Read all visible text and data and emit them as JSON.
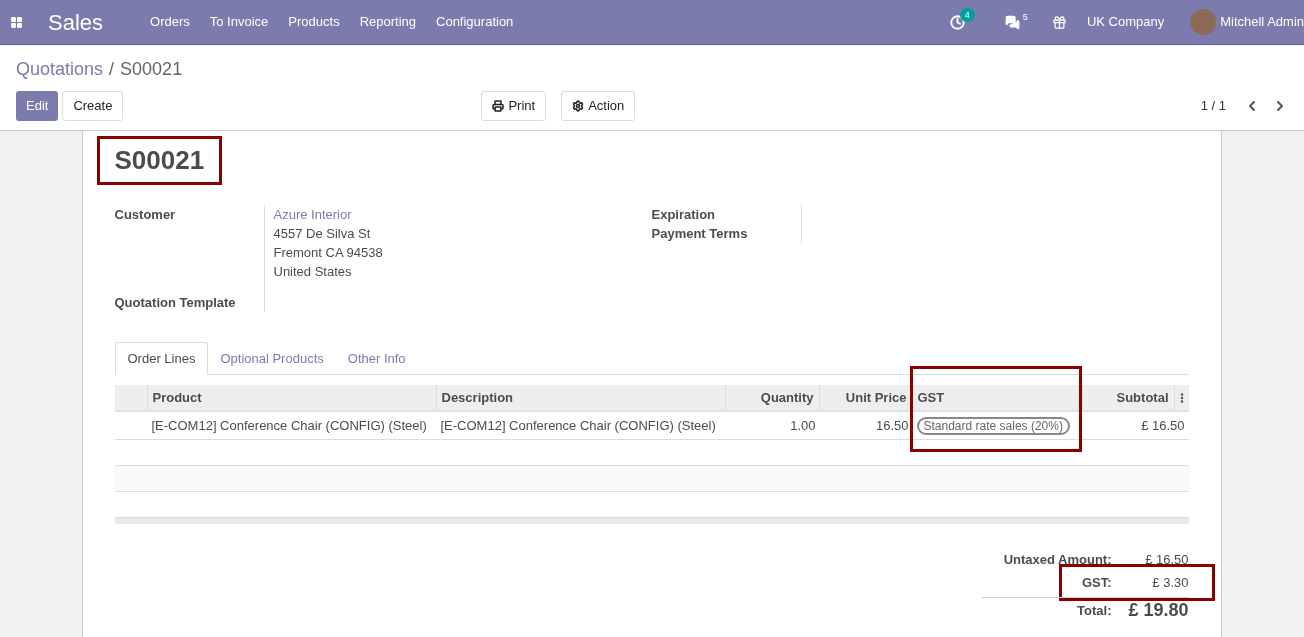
{
  "navbar": {
    "app_name": "Sales",
    "menu": [
      "Orders",
      "To Invoice",
      "Products",
      "Reporting",
      "Configuration"
    ],
    "activity_count": "4",
    "message_count": "5",
    "company": "UK Company",
    "user": "Mitchell Admin"
  },
  "breadcrumb": {
    "parent": "Quotations",
    "separator": "/",
    "current": "S00021"
  },
  "buttons": {
    "edit": "Edit",
    "create": "Create",
    "print": "Print",
    "action": "Action"
  },
  "pager": "1 / 1",
  "form": {
    "title": "S00021",
    "title_highlighted": true,
    "left_fields": [
      {
        "label": "Customer",
        "lines": [
          {
            "text": "Azure Interior",
            "link": true
          },
          {
            "text": "4557 De Silva St",
            "link": false
          },
          {
            "text": "Fremont CA 94538",
            "link": false
          },
          {
            "text": "United States",
            "link": false
          }
        ]
      },
      {
        "label": "Quotation Template"
      }
    ],
    "right_fields": [
      {
        "label": "Expiration"
      },
      {
        "label": "Payment Terms"
      }
    ]
  },
  "tabs": [
    {
      "label": "Order Lines",
      "selected": true
    },
    {
      "label": "Optional Products",
      "selected": false
    },
    {
      "label": "Other Info",
      "selected": false
    }
  ],
  "table": {
    "columns": [
      {
        "label": "Product",
        "highlighted": false
      },
      {
        "label": "Description",
        "highlighted": false
      },
      {
        "label": "Quantity",
        "highlighted": false
      },
      {
        "label": "Unit Price",
        "highlighted": false
      },
      {
        "label": "GST",
        "highlighted": true
      },
      {
        "label": "Subtotal",
        "highlighted": false
      }
    ],
    "rows": [
      [
        "[E-COM12] Conference Chair (CONFIG) (Steel)",
        "[E-COM12] Conference Chair (CONFIG) (Steel)",
        "1.00",
        "16.50",
        {
          "tag": "Standard rate sales (20%)"
        },
        "£ 16.50"
      ]
    ]
  },
  "totals": [
    {
      "label": "Untaxed Amount:",
      "value": "£ 16.50",
      "highlighted": false,
      "kind": "line"
    },
    {
      "label": "GST:",
      "value": "£ 3.30",
      "highlighted": true,
      "kind": "line"
    },
    {
      "label": "Total:",
      "value": "£ 19.80",
      "highlighted": false,
      "kind": "total"
    }
  ]
}
